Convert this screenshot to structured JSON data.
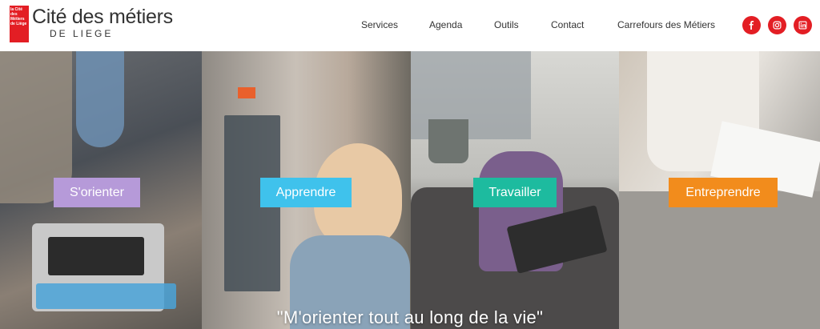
{
  "header": {
    "logo": {
      "box_lines": [
        "la Cité",
        "des Métiers",
        "de Liège"
      ],
      "title": "Cité des métiers",
      "subtitle": "DE LIEGE"
    },
    "nav": [
      {
        "label": "Services"
      },
      {
        "label": "Agenda"
      },
      {
        "label": "Outils"
      },
      {
        "label": "Contact"
      },
      {
        "label": "Carrefours des Métiers"
      }
    ],
    "social": [
      {
        "icon": "facebook-icon"
      },
      {
        "icon": "instagram-icon"
      },
      {
        "icon": "linkedin-icon"
      }
    ],
    "accent_color": "#e31e24"
  },
  "hero": {
    "categories": [
      {
        "label": "S'orienter",
        "color": "#b69ad9"
      },
      {
        "label": "Apprendre",
        "color": "#3fc2ec"
      },
      {
        "label": "Travailler",
        "color": "#1dbb9f"
      },
      {
        "label": "Entreprendre",
        "color": "#f28c1c"
      }
    ],
    "tagline": "\"M'orienter tout au long de la vie\""
  }
}
